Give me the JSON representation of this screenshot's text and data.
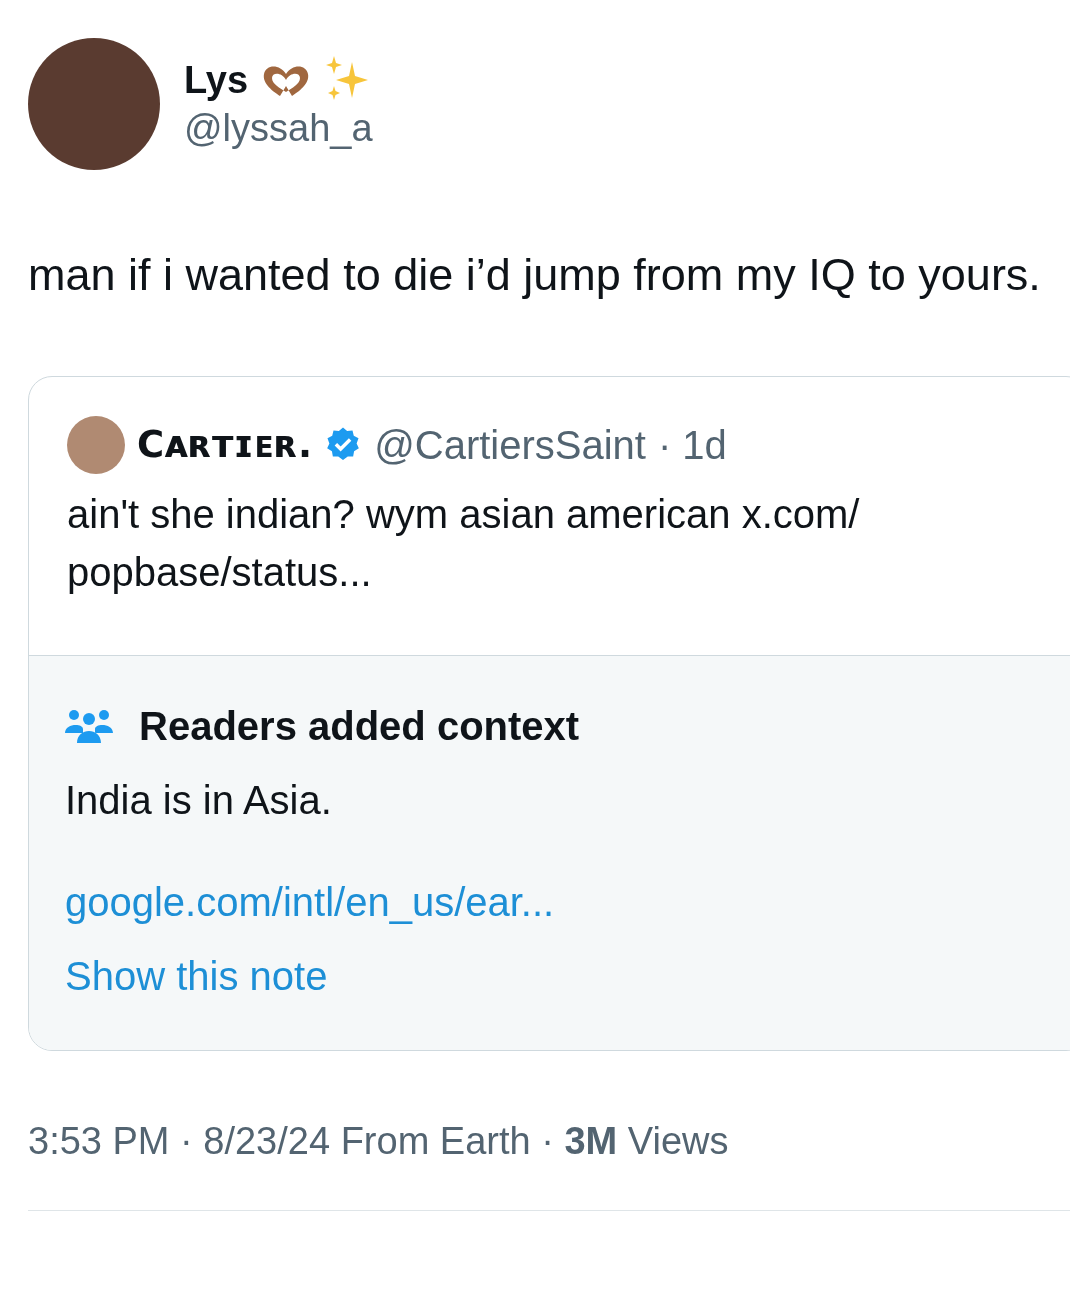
{
  "author": {
    "name": "Lys",
    "handle": "@lyssah_a"
  },
  "text": "man if i wanted to die i’d jump from my IQ to yours.",
  "quoted": {
    "name": "Cᴀʀᴛɪᴇʀ.",
    "verified": true,
    "handle": "@CartiersSaint",
    "time": "· 1d",
    "text": "ain't she indian? wym asian american x.com/ popbase/status...",
    "note": {
      "title": "Readers added context",
      "body": "India is in Asia.",
      "link": "google.com/intl/en_us/ear...",
      "action": "Show this note"
    }
  },
  "meta": "3:53 PM · 8/23/24 From Earth · **3M** Views"
}
